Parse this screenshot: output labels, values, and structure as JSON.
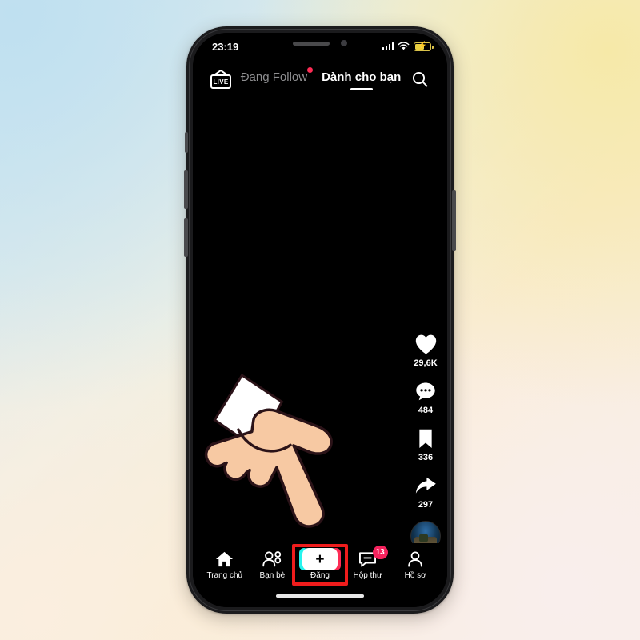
{
  "device": {
    "status_bar": {
      "time": "23:19",
      "signal_icon": "signal-bars-icon",
      "wifi_icon": "wifi-icon",
      "battery_icon": "battery-charging-icon"
    },
    "home_indicator": "home-indicator"
  },
  "header": {
    "live_label": "LIVE",
    "live_icon": "live-tv-icon",
    "tabs": [
      {
        "label": "Đang Follow",
        "active": false,
        "has_dot": true
      },
      {
        "label": "Dành cho bạn",
        "active": true,
        "has_dot": false
      }
    ],
    "search_icon": "search-icon"
  },
  "actions": [
    {
      "icon": "heart-icon",
      "count": "29,6K"
    },
    {
      "icon": "comment-icon",
      "count": "484"
    },
    {
      "icon": "bookmark-icon",
      "count": "336"
    },
    {
      "icon": "share-icon",
      "count": "297"
    }
  ],
  "avatar": {
    "name": "profile-avatar"
  },
  "bottom_nav": [
    {
      "label": "Trang chủ",
      "icon": "home-icon",
      "highlighted": false,
      "badge": ""
    },
    {
      "label": "Bạn bè",
      "icon": "friends-icon",
      "highlighted": false,
      "badge": ""
    },
    {
      "label": "Đăng",
      "icon": "post-plus-icon",
      "highlighted": true,
      "badge": ""
    },
    {
      "label": "Hộp thư",
      "icon": "inbox-icon",
      "highlighted": false,
      "badge": "13"
    },
    {
      "label": "Hồ sơ",
      "icon": "profile-icon",
      "highlighted": false,
      "badge": ""
    }
  ],
  "overlay": {
    "pointer_icon": "pointing-hand-icon",
    "highlight_color": "#ef1c1c"
  },
  "colors": {
    "accent_pink": "#fe2c55",
    "accent_cyan": "#25f4ee",
    "badge": "#f5225d",
    "highlight": "#ef1c1c"
  }
}
